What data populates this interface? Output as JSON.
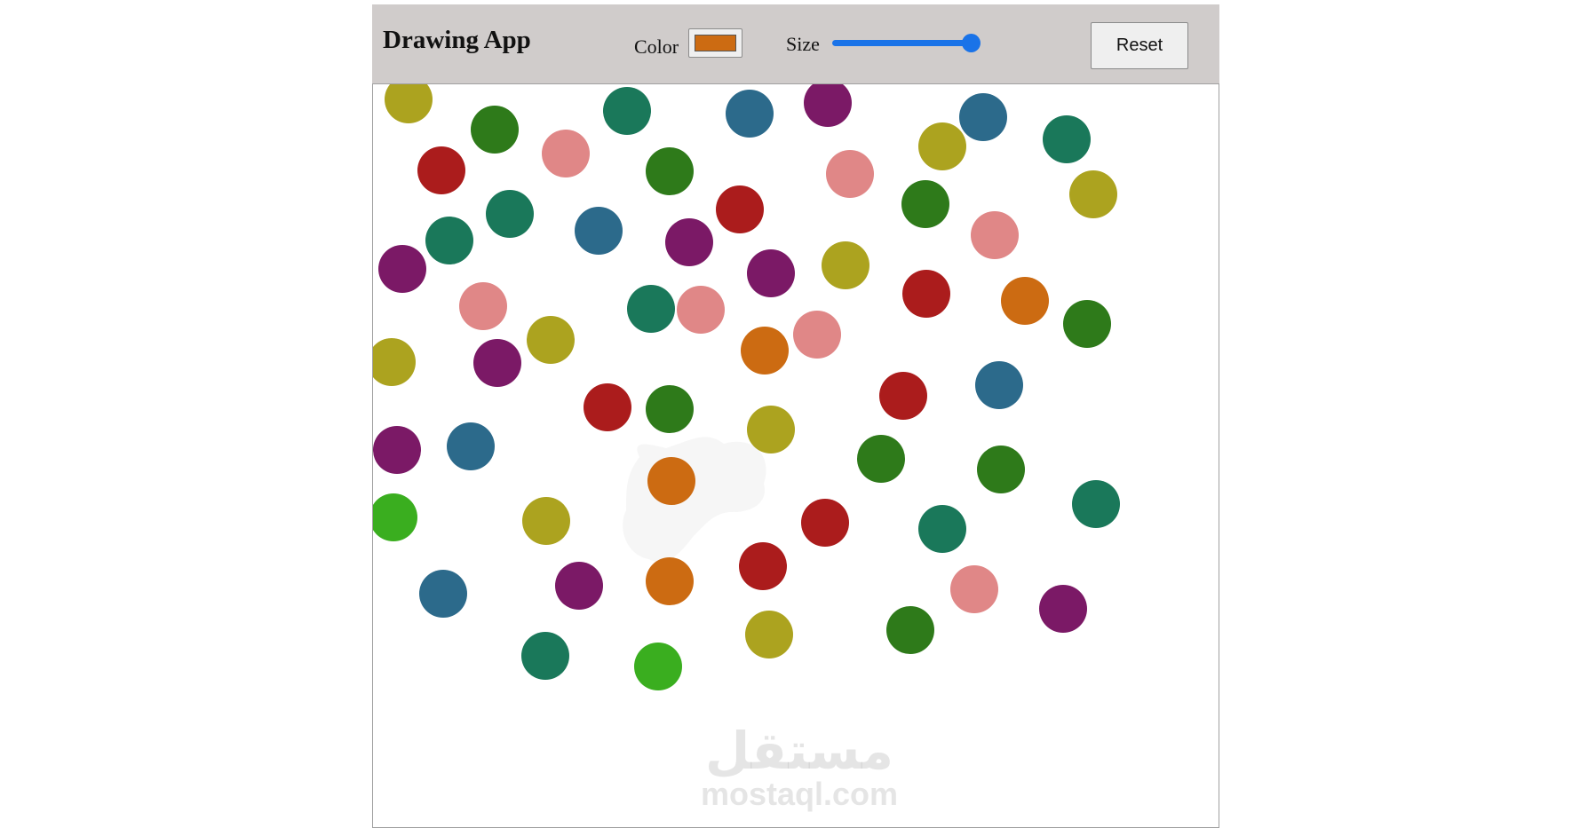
{
  "app": {
    "title": "Drawing App",
    "color_label": "Color",
    "selected_color": "#cc6b12",
    "size_label": "Size",
    "size_level_percent": 96,
    "reset_label": "Reset"
  },
  "canvas": {
    "smudge_color": "#f6f6f6",
    "palette": {
      "olive": "#aca31f",
      "green": "#2e7a1a",
      "pink": "#e08787",
      "teal": "#1a785a",
      "red": "#ab1c1c",
      "blue": "#2c6a8b",
      "purple": "#7b1966",
      "orange": "#cc6b12",
      "lime": "#3aae1f"
    }
  },
  "watermark": {
    "arabic": "مستقل",
    "latin": "mostaql.com"
  }
}
